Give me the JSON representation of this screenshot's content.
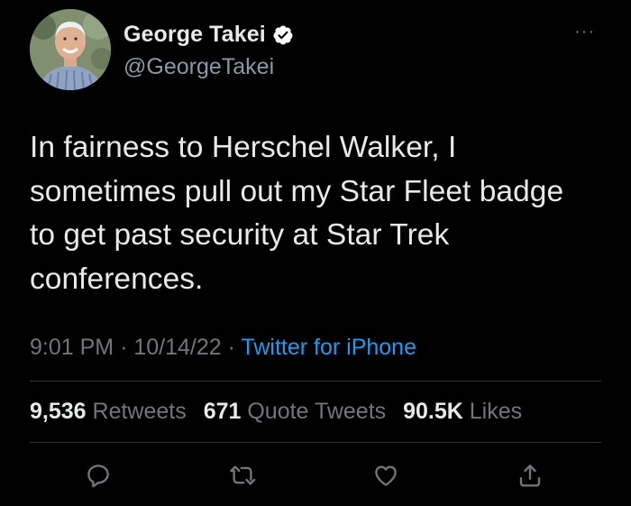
{
  "author": {
    "display_name": "George Takei",
    "handle": "@GeorgeTakei",
    "verified": true,
    "avatar_icon": "profile-photo"
  },
  "tweet": {
    "text": "In fairness to Herschel Walker, I\nsometimes pull out my Star Fleet badge\nto get past security at Star Trek\nconferences.",
    "time": "9:01 PM",
    "separator": "·",
    "date": "10/14/22",
    "source": "Twitter for iPhone"
  },
  "stats": {
    "retweets_count": "9,536",
    "retweets_label": "Retweets",
    "quotes_count": "671",
    "quotes_label": "Quote Tweets",
    "likes_count": "90.5K",
    "likes_label": "Likes"
  },
  "actions": [
    {
      "name": "reply",
      "icon": "reply-icon"
    },
    {
      "name": "retweet",
      "icon": "retweet-icon"
    },
    {
      "name": "like",
      "icon": "heart-icon"
    },
    {
      "name": "share",
      "icon": "share-icon"
    }
  ],
  "more_menu_glyph": "···",
  "colors": {
    "background": "#000000",
    "text_primary": "#e7e9ea",
    "text_secondary": "#71767b",
    "accent": "#1d9bf0",
    "divider": "#2f3336",
    "verified_badge": "#ffffff"
  }
}
